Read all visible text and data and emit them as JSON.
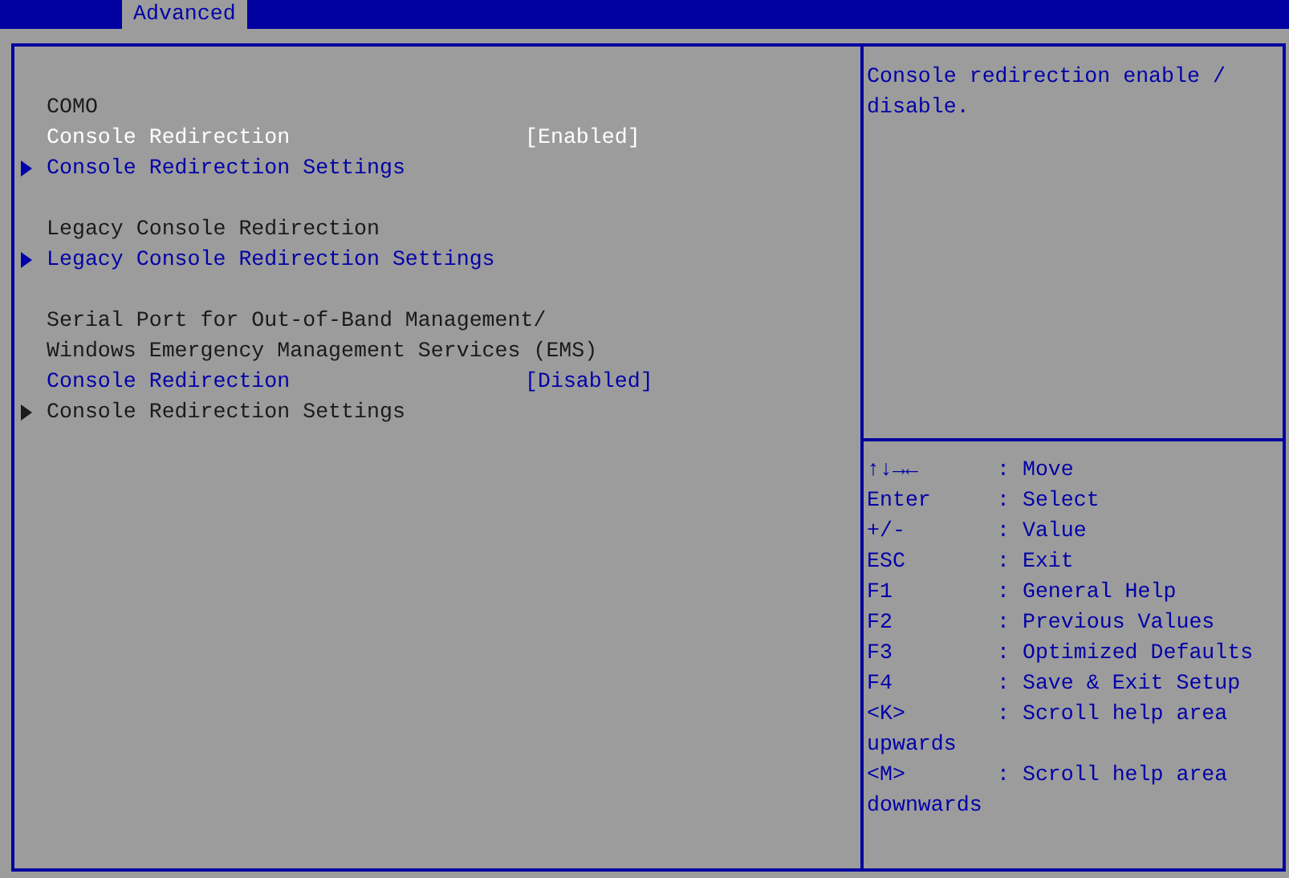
{
  "tabs": [
    {
      "label": "Advanced",
      "selected": true
    }
  ],
  "sections": [
    [
      {
        "kind": "text",
        "label": "COMO"
      },
      {
        "kind": "setting",
        "label": "Console Redirection",
        "value": "[Enabled]",
        "selected": true
      },
      {
        "kind": "submenu",
        "label": "Console Redirection Settings",
        "disabled": false
      }
    ],
    [
      {
        "kind": "text",
        "label": "Legacy Console Redirection"
      },
      {
        "kind": "submenu",
        "label": "Legacy Console Redirection Settings",
        "disabled": false
      }
    ],
    [
      {
        "kind": "text",
        "label": "Serial Port for Out-of-Band Management/"
      },
      {
        "kind": "text",
        "label": "Windows Emergency Management Services (EMS)"
      },
      {
        "kind": "setting",
        "label": "Console Redirection",
        "value": "[Disabled]",
        "selected": false
      },
      {
        "kind": "submenu",
        "label": "Console Redirection Settings",
        "disabled": true
      }
    ]
  ],
  "help_text": "Console redirection enable / disable.",
  "keys": [
    {
      "key": "↑↓→←",
      "desc": ": Move"
    },
    {
      "key": "Enter",
      "desc": ": Select"
    },
    {
      "key": "+/-",
      "desc": ": Value"
    },
    {
      "key": "ESC",
      "desc": ": Exit"
    },
    {
      "key": "F1",
      "desc": ": General Help"
    },
    {
      "key": "F2",
      "desc": ": Previous Values"
    },
    {
      "key": "F3",
      "desc": ": Optimized Defaults"
    },
    {
      "key": "F4",
      "desc": ": Save & Exit Setup"
    },
    {
      "key": "<K>",
      "desc": ": Scroll help area upwards"
    },
    {
      "key": "<M>",
      "desc": ": Scroll help area downwards"
    }
  ]
}
